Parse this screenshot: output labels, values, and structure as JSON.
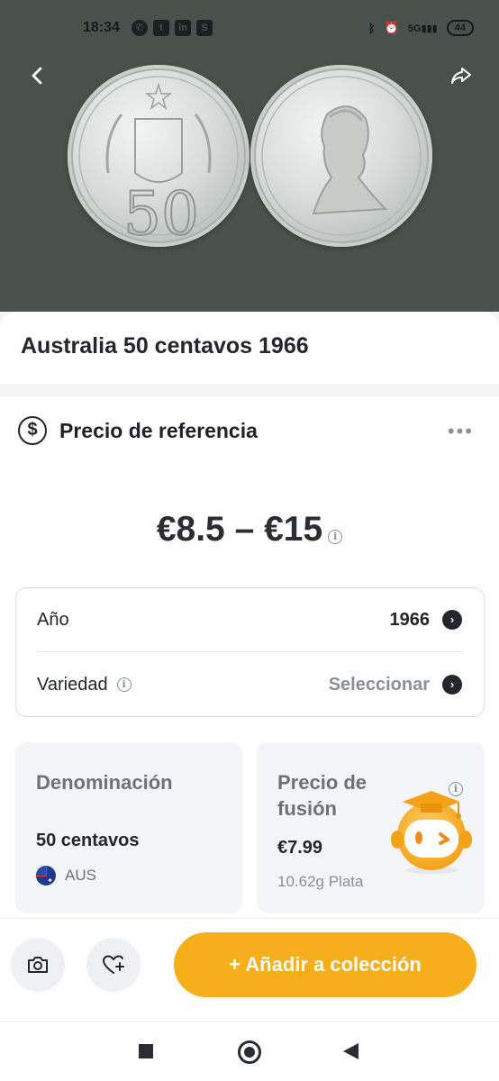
{
  "status_bar": {
    "time": "18:34",
    "battery": "44",
    "left_icons": [
      "whatsapp-icon",
      "twitter-icon",
      "linkedin-icon",
      "s-app-icon"
    ],
    "right_icons": [
      "bluetooth-icon",
      "alarm-icon",
      "signal-5g-icon",
      "battery-icon"
    ]
  },
  "header": {
    "back_icon": "chevron-left-icon",
    "share_icon": "share-icon"
  },
  "coin": {
    "title": "Australia 50 centavos 1966"
  },
  "reference_price": {
    "section_title": "Precio de referencia",
    "icon": "dollar-circle-icon",
    "more_icon": "more-dots-icon",
    "price_range": "€8.5 – €15"
  },
  "details": {
    "year_label": "Año",
    "year_value": "1966",
    "variety_label": "Variedad",
    "variety_value": "Seleccionar"
  },
  "denomination_card": {
    "title": "Denominación",
    "value": "50 centavos",
    "country": "AUS"
  },
  "melt_card": {
    "title_line1": "Precio de",
    "title_line2": "fusión",
    "value": "€7.99",
    "sub": "10.62g Plata"
  },
  "actions": {
    "add_label": "+ Añadir a colección",
    "camera_icon": "camera-icon",
    "favorite_icon": "heart-plus-icon"
  },
  "colors": {
    "accent": "#f6ae1c",
    "hero_bg": "#4a514d",
    "text_dark": "#23262c",
    "text_muted": "#8b9096"
  }
}
